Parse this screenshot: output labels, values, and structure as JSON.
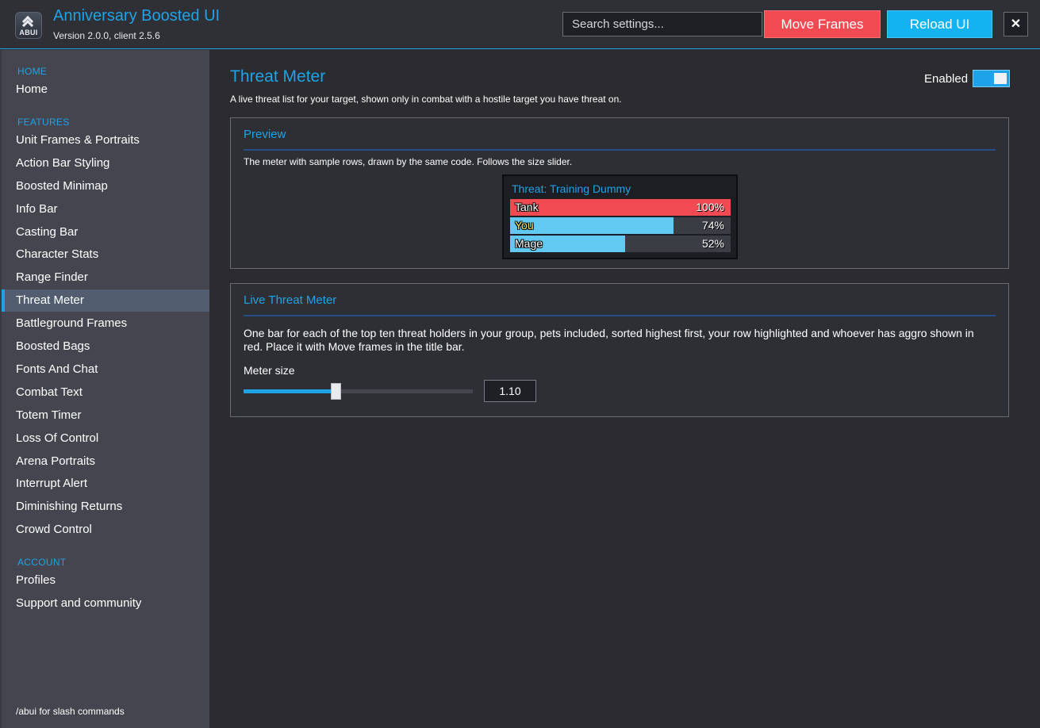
{
  "app": {
    "logo_text": "ABUI",
    "title": "Anniversary Boosted UI",
    "version": "Version 2.0.0, client 2.5.6"
  },
  "header": {
    "search_placeholder": "Search settings...",
    "move_frames_label": "Move Frames",
    "reload_ui_label": "Reload UI",
    "close_label": "✕"
  },
  "sidebar": {
    "sections": [
      {
        "heading": "HOME",
        "items": [
          "Home"
        ]
      },
      {
        "heading": "FEATURES",
        "items": [
          "Unit Frames & Portraits",
          "Action Bar Styling",
          "Boosted Minimap",
          "Info Bar",
          "Casting Bar",
          "Character Stats",
          "Range Finder",
          "Threat Meter",
          "Battleground Frames",
          "Boosted Bags",
          "Fonts And Chat",
          "Combat Text",
          "Totem Timer",
          "Loss Of Control",
          "Arena Portraits",
          "Interrupt Alert",
          "Diminishing Returns",
          "Crowd Control"
        ]
      },
      {
        "heading": "ACCOUNT",
        "items": [
          "Profiles",
          "Support and community"
        ]
      }
    ],
    "active_item": "Threat Meter",
    "footer": "/abui for slash commands"
  },
  "page": {
    "title": "Threat Meter",
    "description": "A live threat list for your target, shown only in combat with a hostile target you have threat on.",
    "enabled_label": "Enabled",
    "enabled": true
  },
  "preview": {
    "title": "Preview",
    "text": "The meter with sample rows, drawn by the same code.  Follows the size slider.",
    "meter_title": "Threat: Training Dummy",
    "rows": [
      {
        "name": "Tank",
        "pct_label": "100%",
        "fraction": 1.0,
        "color": "#f24a53",
        "self": false
      },
      {
        "name": "You",
        "pct_label": "74%",
        "fraction": 0.74,
        "color": "#62c9f2",
        "self": true
      },
      {
        "name": "Mage",
        "pct_label": "52%",
        "fraction": 0.52,
        "color": "#62c9f2",
        "self": false
      }
    ]
  },
  "live": {
    "title": "Live Threat Meter",
    "text": "One bar for each of the top ten threat holders in your group, pets included, sorted highest first, your row highlighted and whoever has aggro shown in red.  Place it with Move frames in the title bar.",
    "slider_label": "Meter size",
    "slider_value": "1.10",
    "slider_fraction": 0.4
  },
  "colors": {
    "accent": "#1fa3e8",
    "danger": "#f24a53",
    "reload": "#13b3f0"
  },
  "icons": {
    "logo": "chevron-up-logo-icon",
    "close": "close-icon"
  }
}
